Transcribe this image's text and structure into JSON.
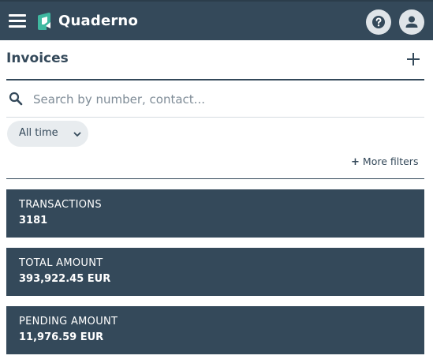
{
  "app": {
    "name": "Quaderno"
  },
  "page": {
    "title": "Invoices"
  },
  "search": {
    "placeholder": "Search by number, contact..."
  },
  "filters": {
    "period": "All time",
    "more_label": "More filters"
  },
  "stats": [
    {
      "label": "TRANSACTIONS",
      "value": "3181"
    },
    {
      "label": "TOTAL AMOUNT",
      "value": "393,922.45 EUR"
    },
    {
      "label": "PENDING AMOUNT",
      "value": "11,976.59 EUR"
    }
  ],
  "colors": {
    "primary": "#34495a",
    "accent": "#3fb8a0",
    "chip": "#e8ecef"
  },
  "icons": [
    "menu-icon",
    "quaderno-logo-icon",
    "help-icon",
    "user-icon",
    "plus-icon",
    "search-icon",
    "chevron-down-icon"
  ]
}
